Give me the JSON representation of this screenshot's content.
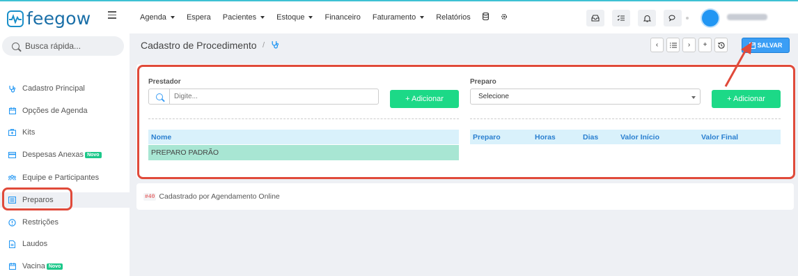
{
  "brand": {
    "name": "feegow",
    "color": "#1a6fa8"
  },
  "nav": [
    {
      "label": "Agenda",
      "caret": true
    },
    {
      "label": "Espera",
      "caret": false
    },
    {
      "label": "Pacientes",
      "caret": true
    },
    {
      "label": "Estoque",
      "caret": true
    },
    {
      "label": "Financeiro",
      "caret": false
    },
    {
      "label": "Faturamento",
      "caret": true
    },
    {
      "label": "Relatórios",
      "caret": false
    }
  ],
  "nav_icons": [
    "database-icon",
    "gear-icon"
  ],
  "toolbar_icons": [
    "inbox-icon",
    "checklist-icon",
    "bell-icon",
    "chat-icon"
  ],
  "sidebar": {
    "search_placeholder": "Busca rápida...",
    "items": [
      {
        "label": "Cadastro Principal",
        "icon": "stethoscope-icon",
        "badge": ""
      },
      {
        "label": "Opções de Agenda",
        "icon": "calendar-icon",
        "badge": ""
      },
      {
        "label": "Kits",
        "icon": "kit-icon",
        "badge": ""
      },
      {
        "label": "Despesas Anexas",
        "icon": "card-icon",
        "badge": "Novo"
      },
      {
        "label": "Equipe e Participantes",
        "icon": "team-icon",
        "badge": ""
      },
      {
        "label": "Preparos",
        "icon": "list-icon",
        "badge": "",
        "active": true
      },
      {
        "label": "Restrições",
        "icon": "alert-icon",
        "badge": ""
      },
      {
        "label": "Laudos",
        "icon": "document-icon",
        "badge": ""
      },
      {
        "label": "Vacina",
        "icon": "calendar-icon",
        "badge": "Novo"
      }
    ]
  },
  "header": {
    "title": "Cadastro de Procedimento",
    "crumb_sep": "/",
    "save_label": "SALVAR"
  },
  "form": {
    "prestador_label": "Prestador",
    "prestador_placeholder": "Digite...",
    "add_label": "+ Adicionar",
    "preparo_label": "Preparo",
    "preparo_selected": "Selecione"
  },
  "left_table": {
    "headers": [
      "Nome"
    ],
    "rows": [
      [
        "PREPARO PADRÃO"
      ]
    ]
  },
  "right_table": {
    "headers": [
      "Preparo",
      "Horas",
      "Dias",
      "Valor Início",
      "Valor Final"
    ],
    "rows": []
  },
  "footer_note": {
    "code": "#40",
    "text": "Cadastrado por Agendamento Online"
  },
  "colors": {
    "accent": "#3b9ef5",
    "success": "#1cd987",
    "highlight": "#e04a3a"
  }
}
